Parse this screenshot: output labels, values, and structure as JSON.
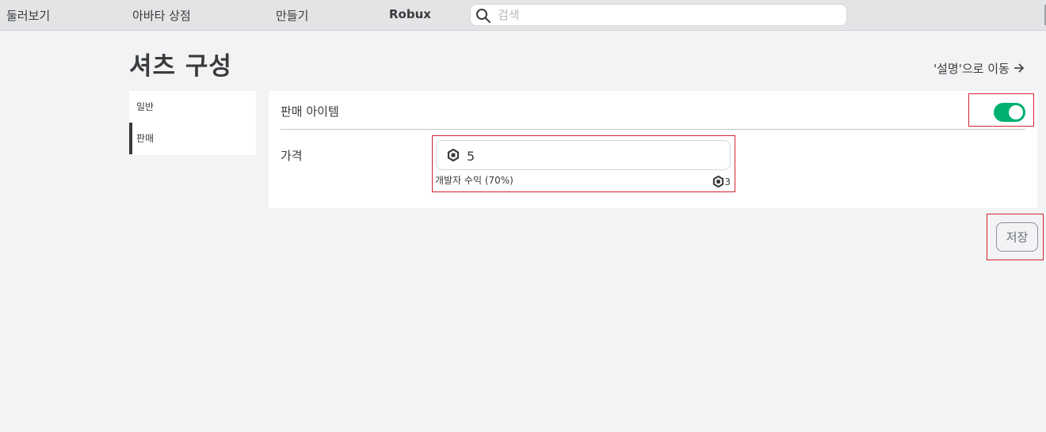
{
  "nav": {
    "items": [
      {
        "label": "둘러보기"
      },
      {
        "label": "아바타 상점"
      },
      {
        "label": "만들기"
      },
      {
        "label": "Robux"
      }
    ],
    "search": {
      "placeholder": "검색",
      "value": "",
      "icon": "search-icon"
    }
  },
  "page": {
    "title": "셔츠 구성",
    "goto_link": "'설명'으로 이동"
  },
  "sidebar": {
    "items": [
      {
        "label": "일반",
        "active": false
      },
      {
        "label": "판매",
        "active": true
      }
    ]
  },
  "sale": {
    "item_for_sale_label": "판매 아이템",
    "item_for_sale_on": true,
    "price_label": "가격",
    "price_value": "5",
    "earnings_label": "개발자 수익 (70%)",
    "earnings_value": "3",
    "currency_icon": "robux-icon"
  },
  "actions": {
    "save_label": "저장"
  },
  "colors": {
    "toggle_on": "#00b06f",
    "highlight_box": "#d3232f"
  }
}
